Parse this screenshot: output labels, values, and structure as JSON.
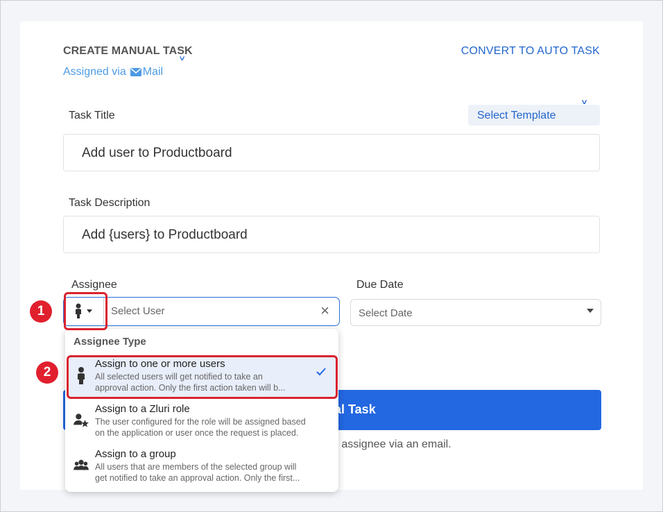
{
  "header": {
    "title": "CREATE MANUAL TASK",
    "assigned_prefix": "Assigned via",
    "assigned_channel": "Mail",
    "convert_label": "CONVERT TO AUTO TASK"
  },
  "task_title": {
    "label": "Task Title",
    "value": "Add user to Productboard",
    "template_label": "Select Template"
  },
  "task_description": {
    "label": "Task Description",
    "value": "Add {users} to Productboard"
  },
  "assignee": {
    "label": "Assignee",
    "placeholder": "Select User"
  },
  "due_date": {
    "label": "Due Date",
    "placeholder": "Select Date"
  },
  "create_button_label": "ual Task",
  "footer_note": "e assignee via an email.",
  "dropdown": {
    "heading": "Assignee Type",
    "options": [
      {
        "title": "Assign to one or more users",
        "desc1": "All selected users will get notified to take an",
        "desc2": "approval action. Only the first action taken will b...",
        "icon": "user-icon",
        "selected": true
      },
      {
        "title": "Assign to a Zluri role",
        "desc1": "The user configured for the role will be assigned based",
        "desc2": "on the application or user once the request is placed.",
        "icon": "user-star-icon",
        "selected": false
      },
      {
        "title": "Assign to a group",
        "desc1": "All users that are members of the selected group will",
        "desc2": "get notified to take an approval action. Only the first...",
        "icon": "group-icon",
        "selected": false
      }
    ]
  },
  "callouts": [
    "1",
    "2"
  ],
  "colors": {
    "accent": "#2367e1",
    "callout": "#e1202e",
    "link": "#2266cc"
  }
}
